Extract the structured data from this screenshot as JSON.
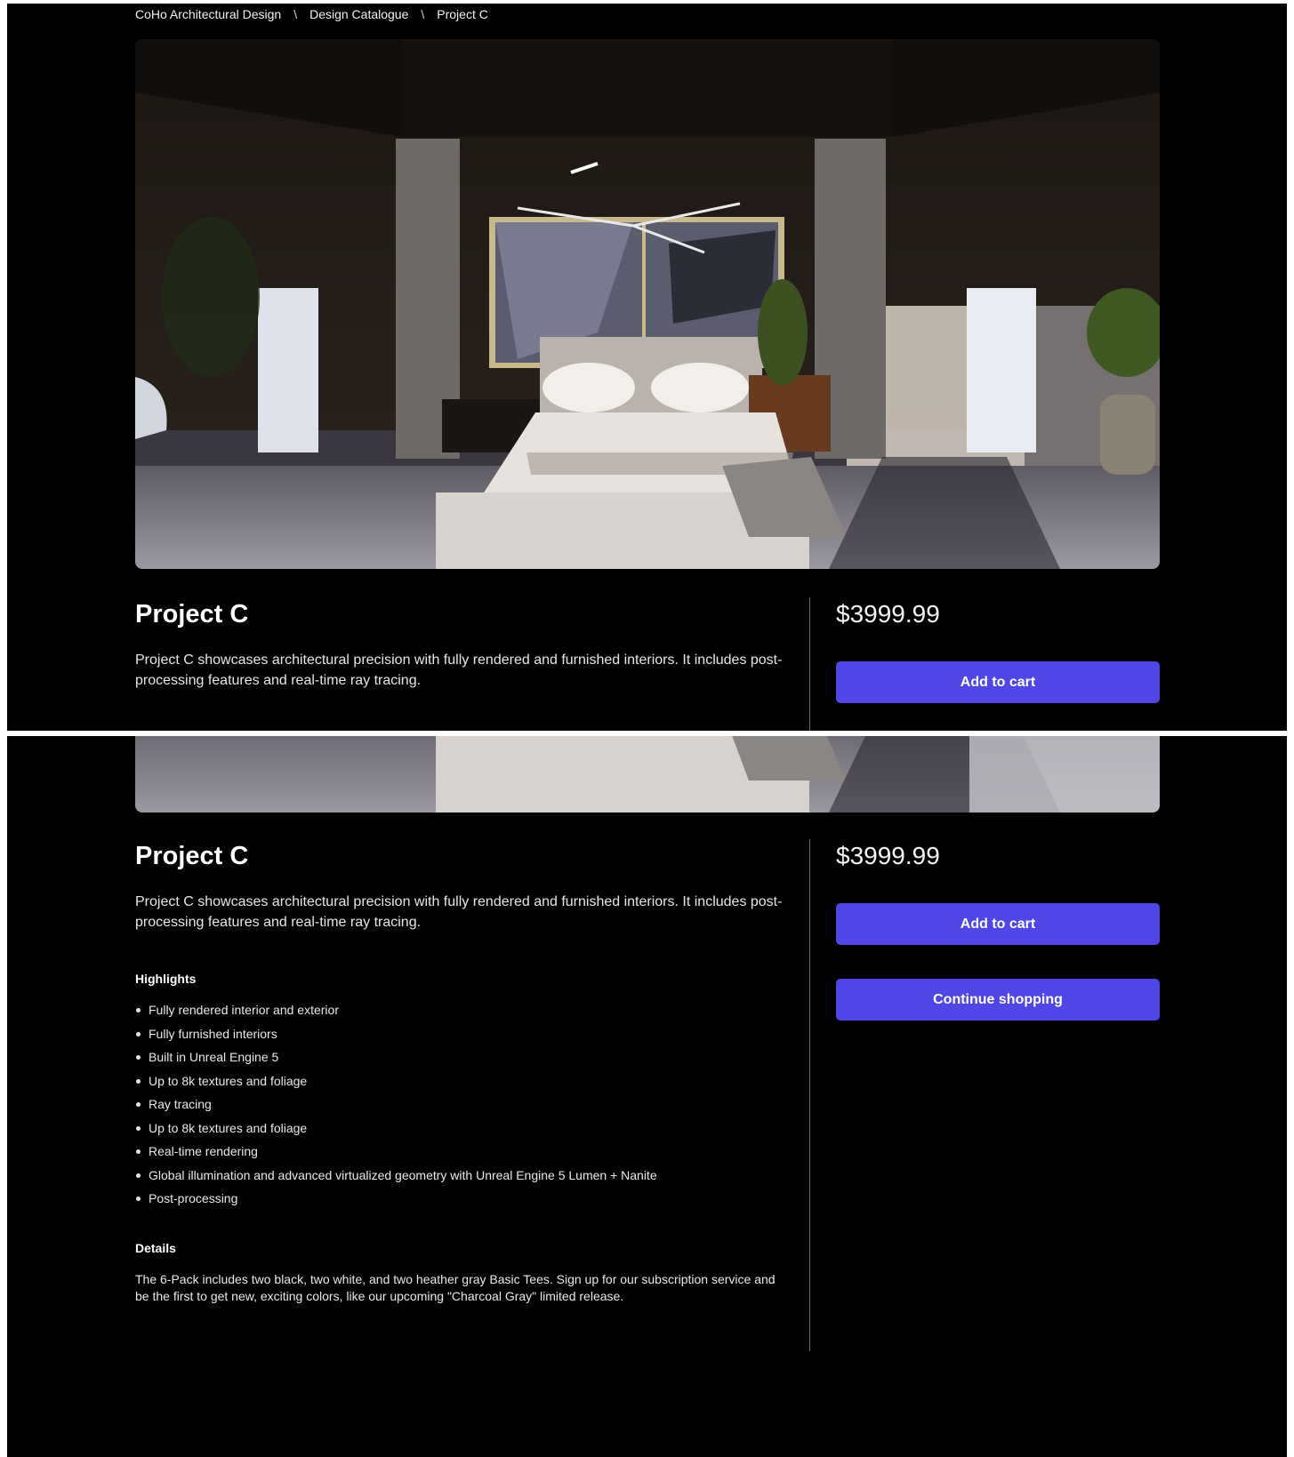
{
  "breadcrumb": {
    "items": [
      "CoHo Architectural Design",
      "Design Catalogue",
      "Project C"
    ],
    "separator": "\\"
  },
  "product": {
    "title": "Project C",
    "description": "Project C showcases architectural precision with fully rendered and furnished interiors. It includes post-processing features and real-time ray tracing.",
    "price": "$3999.99"
  },
  "actions": {
    "add_to_cart": "Add to cart",
    "continue_shopping": "Continue shopping"
  },
  "highlights": {
    "title": "Highlights",
    "items": [
      "Fully rendered interior and exterior",
      "Fully furnished interiors",
      "Built in Unreal Engine 5",
      "Up to 8k textures and foliage",
      "Ray tracing",
      "Up to 8k textures and foliage",
      "Real-time rendering",
      "Global illumination and advanced virtualized geometry with Unreal Engine 5 Lumen + Nanite",
      "Post-processing"
    ]
  },
  "details": {
    "title": "Details",
    "text": "The 6-Pack includes two black, two white, and two heather gray Basic Tees. Sign up for our subscription service and be the first to get new, exciting colors, like our upcoming \"Charcoal Gray\" limited release."
  },
  "colors": {
    "background": "#000000",
    "accent": "#4f46e5",
    "divider": "#6a6a6a"
  }
}
